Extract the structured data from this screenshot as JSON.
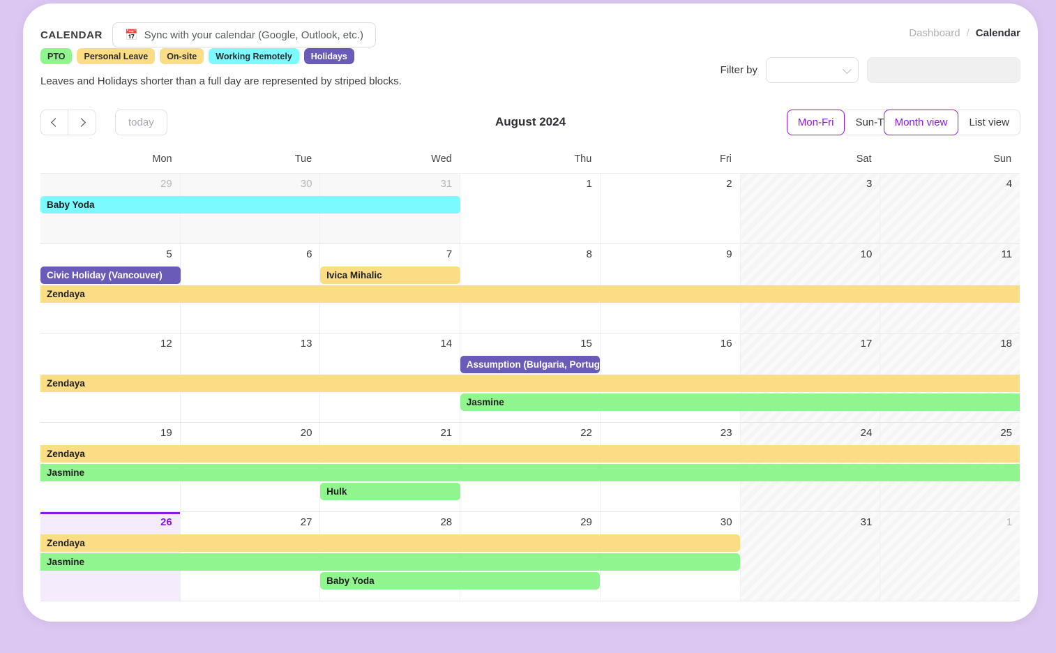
{
  "page": {
    "background": "#dcc7f2",
    "accent": "#8b16f0"
  },
  "header": {
    "title": "CALENDAR",
    "sync_button_label": "Sync with your calendar (Google, Outlook, etc.)",
    "sync_icon": "calendar-icon",
    "breadcrumb": {
      "parent": "Dashboard",
      "separator": "/",
      "current": "Calendar"
    }
  },
  "legend": {
    "items": [
      {
        "label": "PTO",
        "color": "#90f58f"
      },
      {
        "label": "Personal Leave",
        "color": "#fbdd85"
      },
      {
        "label": "On-site",
        "color": "#fbdd85"
      },
      {
        "label": "Working Remotely",
        "color": "#7bfaff"
      },
      {
        "label": "Holidays",
        "color": "#6a5bb8"
      }
    ],
    "note": "Leaves and Holidays shorter than a full day are represented by striped blocks."
  },
  "filter": {
    "label": "Filter by",
    "select_value": "",
    "select_placeholder": "",
    "input_value": "",
    "input_placeholder": "",
    "chevron_icon": "chevron-down-icon"
  },
  "toolbar": {
    "prev_icon": "chevron-left-icon",
    "next_icon": "chevron-right-icon",
    "today_label": "today",
    "month_title": "August 2024",
    "weekday_modes": [
      {
        "label": "Mon-Fri",
        "active": true
      },
      {
        "label": "Sun-Thu",
        "active": false
      }
    ],
    "view_modes": [
      {
        "label": "Month view",
        "active": true
      },
      {
        "label": "List view",
        "active": false
      }
    ]
  },
  "calendar": {
    "day_headers": [
      "Mon",
      "Tue",
      "Wed",
      "Thu",
      "Fri",
      "Sat",
      "Sun"
    ],
    "weekend_columns": [
      5,
      6
    ],
    "weeks": [
      {
        "days": [
          {
            "num": "29",
            "other_month": true
          },
          {
            "num": "30",
            "other_month": true
          },
          {
            "num": "31",
            "other_month": true
          },
          {
            "num": "1",
            "other_month": false
          },
          {
            "num": "2",
            "other_month": false
          },
          {
            "num": "3",
            "other_month": false
          },
          {
            "num": "4",
            "other_month": false
          }
        ],
        "rows": [
          [
            {
              "title": "Baby Yoda",
              "start": 0,
              "end": 2,
              "color": "#7bfaff",
              "text": "dark",
              "clip_left": false,
              "clip_right": false
            }
          ]
        ],
        "filler_rows": 1
      },
      {
        "days": [
          {
            "num": "5",
            "other_month": false
          },
          {
            "num": "6",
            "other_month": false
          },
          {
            "num": "7",
            "other_month": false
          },
          {
            "num": "8",
            "other_month": false
          },
          {
            "num": "9",
            "other_month": false
          },
          {
            "num": "10",
            "other_month": false
          },
          {
            "num": "11",
            "other_month": false
          }
        ],
        "rows": [
          [
            {
              "title": "Civic Holiday (Vancouver)",
              "start": 0,
              "end": 0,
              "color": "#6a5bb8",
              "text": "light",
              "clip_left": false,
              "clip_right": false
            },
            {
              "title": "Ivica Mihalic",
              "start": 2,
              "end": 2,
              "color": "#fbdd85",
              "text": "dark",
              "clip_left": false,
              "clip_right": false
            }
          ],
          [
            {
              "title": "Zendaya",
              "start": 0,
              "end": 6,
              "color": "#fbdd85",
              "text": "dark",
              "clip_left": true,
              "clip_right": true
            }
          ]
        ],
        "filler_rows": 1
      },
      {
        "days": [
          {
            "num": "12",
            "other_month": false
          },
          {
            "num": "13",
            "other_month": false
          },
          {
            "num": "14",
            "other_month": false
          },
          {
            "num": "15",
            "other_month": false
          },
          {
            "num": "16",
            "other_month": false
          },
          {
            "num": "17",
            "other_month": false
          },
          {
            "num": "18",
            "other_month": false
          }
        ],
        "rows": [
          [
            {
              "title": "Assumption (Bulgaria, Portugal, Austria)",
              "start": 3,
              "end": 3,
              "color": "#6a5bb8",
              "text": "light",
              "clip_left": false,
              "clip_right": false
            }
          ],
          [
            {
              "title": "Zendaya",
              "start": 0,
              "end": 6,
              "color": "#fbdd85",
              "text": "dark",
              "clip_left": true,
              "clip_right": true
            }
          ],
          [
            {
              "title": "Jasmine",
              "start": 3,
              "end": 6,
              "color": "#90f58f",
              "text": "dark",
              "clip_left": false,
              "clip_right": true
            }
          ]
        ],
        "filler_rows": 0
      },
      {
        "days": [
          {
            "num": "19",
            "other_month": false
          },
          {
            "num": "20",
            "other_month": false
          },
          {
            "num": "21",
            "other_month": false
          },
          {
            "num": "22",
            "other_month": false
          },
          {
            "num": "23",
            "other_month": false
          },
          {
            "num": "24",
            "other_month": false
          },
          {
            "num": "25",
            "other_month": false
          }
        ],
        "rows": [
          [
            {
              "title": "Zendaya",
              "start": 0,
              "end": 6,
              "color": "#fbdd85",
              "text": "dark",
              "clip_left": true,
              "clip_right": true
            }
          ],
          [
            {
              "title": "Jasmine",
              "start": 0,
              "end": 6,
              "color": "#90f58f",
              "text": "dark",
              "clip_left": true,
              "clip_right": true
            }
          ],
          [
            {
              "title": "Hulk",
              "start": 2,
              "end": 2,
              "color": "#90f58f",
              "text": "dark",
              "clip_left": false,
              "clip_right": false
            }
          ]
        ],
        "filler_rows": 0
      },
      {
        "days": [
          {
            "num": "26",
            "other_month": false,
            "today": true
          },
          {
            "num": "27",
            "other_month": false
          },
          {
            "num": "28",
            "other_month": false
          },
          {
            "num": "29",
            "other_month": false
          },
          {
            "num": "30",
            "other_month": false
          },
          {
            "num": "31",
            "other_month": false
          },
          {
            "num": "1",
            "other_month": true
          }
        ],
        "rows": [
          [
            {
              "title": "Zendaya",
              "start": 0,
              "end": 4,
              "color": "#fbdd85",
              "text": "dark",
              "clip_left": true,
              "clip_right": false
            }
          ],
          [
            {
              "title": "Jasmine",
              "start": 0,
              "end": 4,
              "color": "#90f58f",
              "text": "dark",
              "clip_left": true,
              "clip_right": false
            }
          ],
          [
            {
              "title": "Baby Yoda",
              "start": 2,
              "end": 3,
              "color": "#90f58f",
              "text": "dark",
              "clip_left": false,
              "clip_right": false
            }
          ]
        ],
        "filler_rows": 0
      }
    ]
  }
}
